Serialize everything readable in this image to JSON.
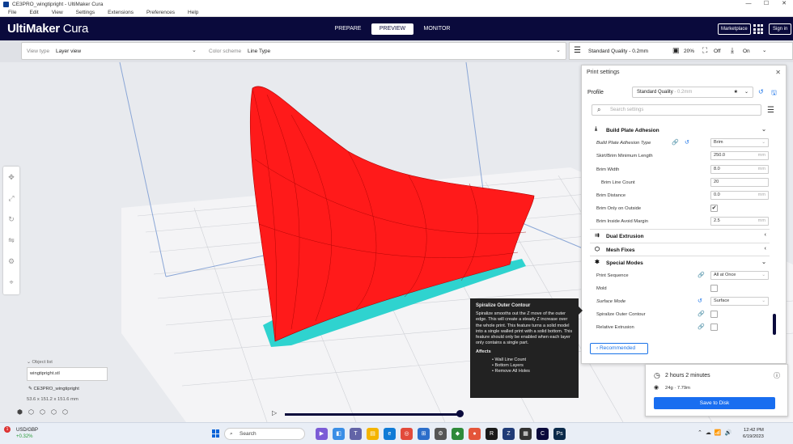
{
  "window": {
    "title": "CE3PRO_wingtipright - UltiMaker Cura",
    "minimize": "—",
    "maximize": "☐",
    "close": "✕"
  },
  "menu": [
    "File",
    "Edit",
    "View",
    "Settings",
    "Extensions",
    "Preferences",
    "Help"
  ],
  "header": {
    "logo_bold": "UltiMaker",
    "logo_light": " Cura",
    "stages": [
      "PREPARE",
      "PREVIEW",
      "MONITOR"
    ],
    "active_stage": "PREVIEW",
    "marketplace": "Marketplace",
    "signin": "Sign in"
  },
  "view_bar": {
    "view_type_label": "View type",
    "view_type_value": "Layer view",
    "color_scheme_label": "Color scheme",
    "color_scheme_value": "Line Type"
  },
  "print_bar": {
    "quality": "Standard Quality - 0.2mm",
    "infill": "20%",
    "support": "Off",
    "adhesion": "On"
  },
  "panel": {
    "title": "Print settings",
    "close": "✕",
    "profile_label": "Profile",
    "profile_value": "Standard Quality",
    "profile_suffix": " - 0.2mm",
    "search_placeholder": "Search settings",
    "recommended": "Recommended",
    "categories": {
      "build_plate": "Build Plate Adhesion",
      "dual": "Dual Extrusion",
      "mesh": "Mesh Fixes",
      "special": "Special Modes"
    },
    "settings": {
      "adhesion_type": {
        "label": "Build Plate Adhesion Type",
        "value": "Brim"
      },
      "skirt_min": {
        "label": "Skirt/Brim Minimum Length",
        "value": "250.0",
        "unit": "mm"
      },
      "brim_width": {
        "label": "Brim Width",
        "value": "8.0",
        "unit": "mm"
      },
      "brim_lines": {
        "label": "Brim Line Count",
        "value": "20"
      },
      "brim_distance": {
        "label": "Brim Distance",
        "value": "0.0",
        "unit": "mm"
      },
      "brim_outside": {
        "label": "Brim Only on Outside",
        "checked": "✔"
      },
      "brim_avoid": {
        "label": "Brim Inside Avoid Margin",
        "value": "2.5",
        "unit": "mm"
      },
      "print_sequence": {
        "label": "Print Sequence",
        "value": "All at Once"
      },
      "mold": {
        "label": "Mold"
      },
      "surface_mode": {
        "label": "Surface Mode",
        "value": "Surface"
      },
      "spiralize": {
        "label": "Spiralize Outer Contour"
      },
      "relative": {
        "label": "Relative Extrusion"
      }
    }
  },
  "tooltip": {
    "title": "Spiralize Outer Contour",
    "body": "Spiralize smooths out the Z move of the outer edge. This will create a steady Z increase over the whole print. This feature turns a solid model into a single walled print with a solid bottom. This feature should only be enabled when each layer only contains a single part.",
    "affects_label": "Affects",
    "affects": [
      "Wall Line Count",
      "Bottom Layers",
      "Remove All Holes"
    ]
  },
  "object_list": {
    "header": "Object list",
    "file": "wingtipright.stl",
    "name": "CE3PRO_wingtipright",
    "dims": "53.6 x 151.2 x 151.6 mm"
  },
  "print_info": {
    "time": "2 hours 2 minutes",
    "material": "24g · 7.79m",
    "save": "Save to Disk"
  },
  "taskbar": {
    "ticker": "USD/GBP",
    "change": "+0.32%",
    "badge": "1",
    "search": "Search",
    "time": "12:42 PM",
    "date": "6/19/2023"
  },
  "colors": {
    "header": "#0a0a3c",
    "model": "#ff1a1a",
    "brim": "#2fd3cf",
    "accent": "#196ef0"
  }
}
